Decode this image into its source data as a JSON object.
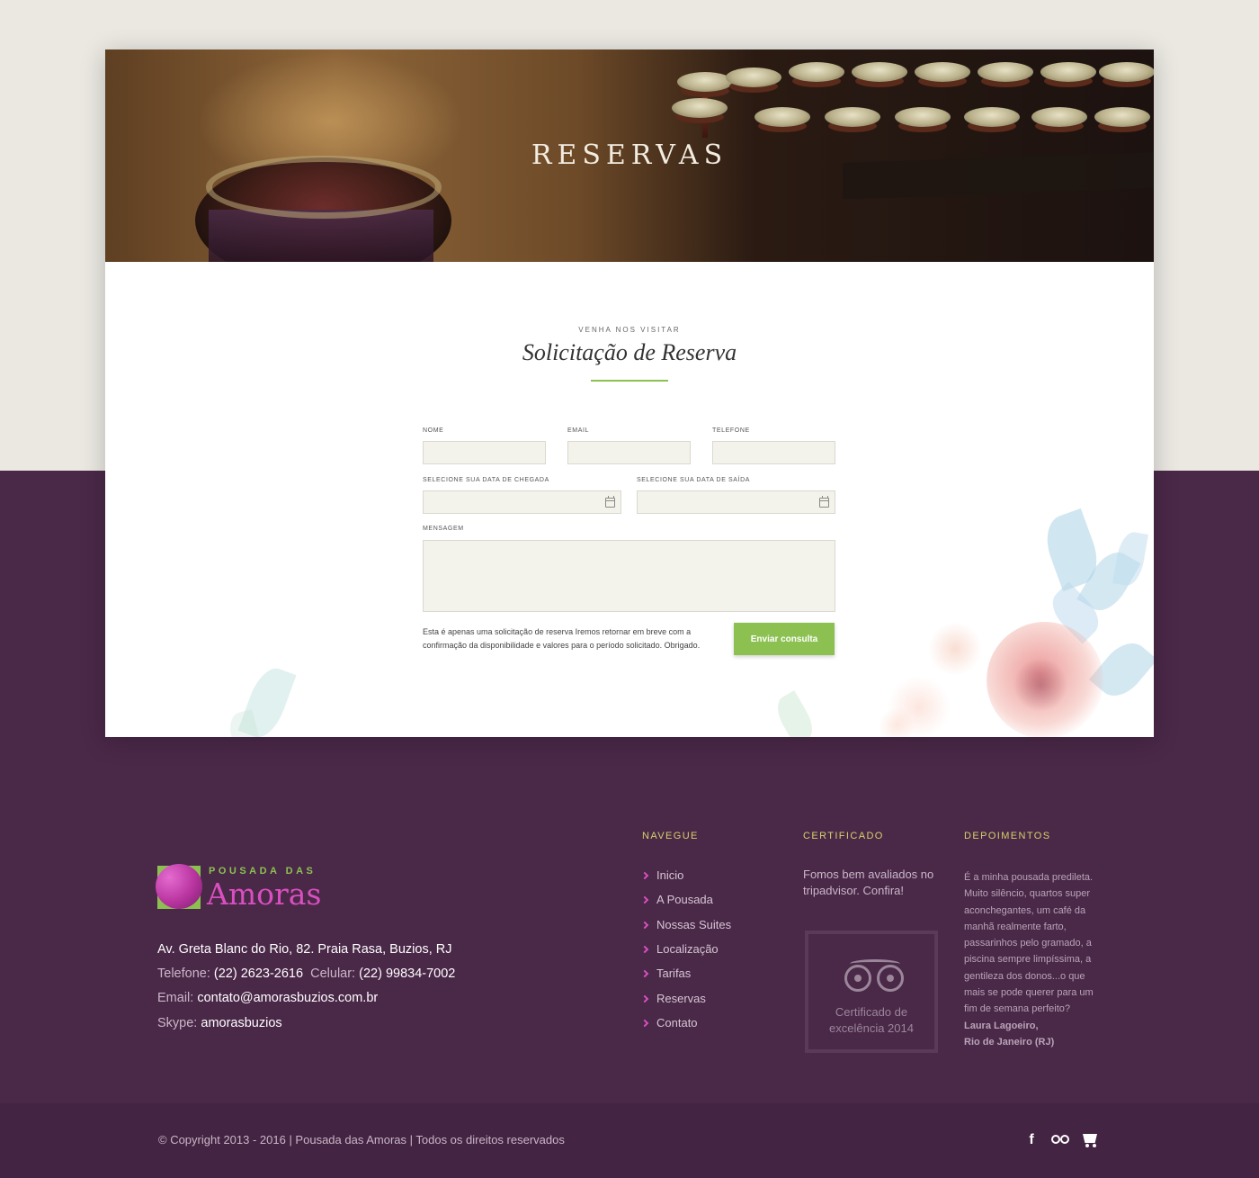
{
  "hero": {
    "title": "RESERVAS"
  },
  "form": {
    "eyebrow": "VENHA NOS VISITAR",
    "heading": "Solicitação de Reserva",
    "fields": {
      "nome": {
        "label": "NOME",
        "value": ""
      },
      "email": {
        "label": "EMAIL",
        "value": ""
      },
      "telefone": {
        "label": "TELEFONE",
        "value": ""
      },
      "chegada": {
        "label": "SELECIONE SUA DATA DE CHEGADA",
        "value": ""
      },
      "saida": {
        "label": "SELECIONE SUA DATA DE SAÍDA",
        "value": ""
      },
      "mensagem": {
        "label": "MENSAGEM",
        "value": ""
      }
    },
    "note": "Esta é apenas uma solicitação de reserva Iremos retornar em breve com a confirmação da disponibilidade e valores para o período solicitado. Obrigado.",
    "submit_label": "Enviar consulta"
  },
  "footer": {
    "logo": {
      "small": "POUSADA DAS",
      "big": "Amoras"
    },
    "address": "Av. Greta Blanc do Rio, 82. Praia Rasa, Buzios, RJ",
    "phone_label": "Telefone:",
    "phone": "(22) 2623-2616",
    "cell_label": "Celular:",
    "cell": "(22) 99834-7002",
    "email_label": "Email:",
    "email": "contato@amorasbuzios.com.br",
    "skype_label": "Skype:",
    "skype": "amorasbuzios",
    "nav_title": "NAVEGUE",
    "nav": [
      "Inicio",
      "A Pousada",
      "Nossas Suites",
      "Localização",
      "Tarifas",
      "Reservas",
      "Contato"
    ],
    "cert_title": "CERTIFICADO",
    "cert_text": "Fomos bem avaliados no tripadvisor. Confira!",
    "cert_badge": "Certificado de excelência 2014",
    "dep_title": "DEPOIMENTOS",
    "dep_text": "É a minha pousada predileta. Muito silêncio, quartos super aconchegantes, um café da manhã realmente farto, passarinhos pelo gramado, a piscina sempre limpíssima, a gentileza dos donos...o que mais se pode querer para um fim de semana perfeito?",
    "dep_author": "Laura Lagoeiro,",
    "dep_place": "Rio de Janeiro (RJ)",
    "copyright": "© Copyright 2013 - 2016 | Pousada das Amoras | Todos os direitos reservados"
  },
  "colors": {
    "accent_green": "#8cc152",
    "purple": "#4a2848",
    "title_yellow": "#d7d16a",
    "pink": "#d94fbf"
  },
  "icons": [
    "calendar-icon",
    "chevron-right-icon",
    "tripadvisor-owl-icon",
    "facebook-icon",
    "tripadvisor-icon",
    "cart-icon"
  ]
}
